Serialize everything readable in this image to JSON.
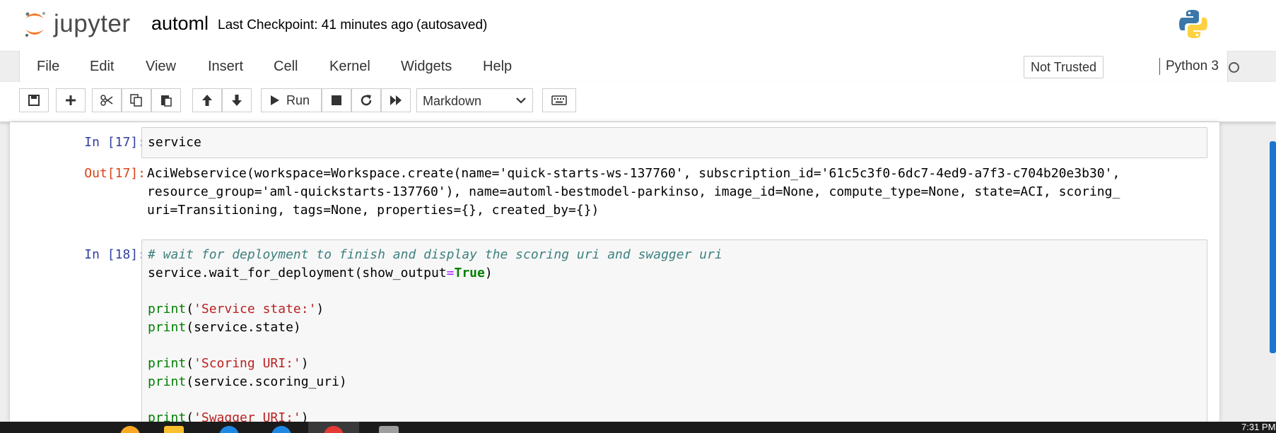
{
  "header": {
    "logo_text": "jupyter",
    "notebook_name": "automl",
    "checkpoint": "Last Checkpoint: 41 minutes ago",
    "autosave": "(autosaved)"
  },
  "menu": {
    "items": [
      "File",
      "Edit",
      "View",
      "Insert",
      "Cell",
      "Kernel",
      "Widgets",
      "Help"
    ],
    "trust": "Not Trusted",
    "kernel": "Python 3"
  },
  "toolbar": {
    "run_label": "Run",
    "cell_type": "Markdown"
  },
  "cells": {
    "c17": {
      "in_prompt": "In [17]:",
      "code": "service",
      "out_prompt": "Out[17]:",
      "out_lines": [
        "AciWebservice(workspace=Workspace.create(name='quick-starts-ws-137760', subscription_id='61c5c3f0-6dc7-4ed9-a7f3-c704b20e3b30',",
        "resource_group='aml-quickstarts-137760'), name=automl-bestmodel-parkinso, image_id=None, compute_type=None, state=ACI, scoring_",
        "uri=Transitioning, tags=None, properties={}, created_by={})"
      ]
    },
    "c18": {
      "in_prompt": "In [18]:",
      "comment": "# wait for deployment to finish and display the scoring uri and swagger uri",
      "l2_a": "service.wait_for_deployment(show_output",
      "l2_op": "=",
      "l2_kw": "True",
      "l2_b": ")",
      "print": "print",
      "l4_str": "'Service state:'",
      "l5_arg": "(service.state)",
      "l7_str": "'Scoring URI:'",
      "l8_arg": "(service.scoring_uri)",
      "l10_str": "'Swagger URI:'",
      "paren_open": "(",
      "paren_close": ")"
    }
  },
  "taskbar": {
    "clock": "7:31 PM"
  }
}
